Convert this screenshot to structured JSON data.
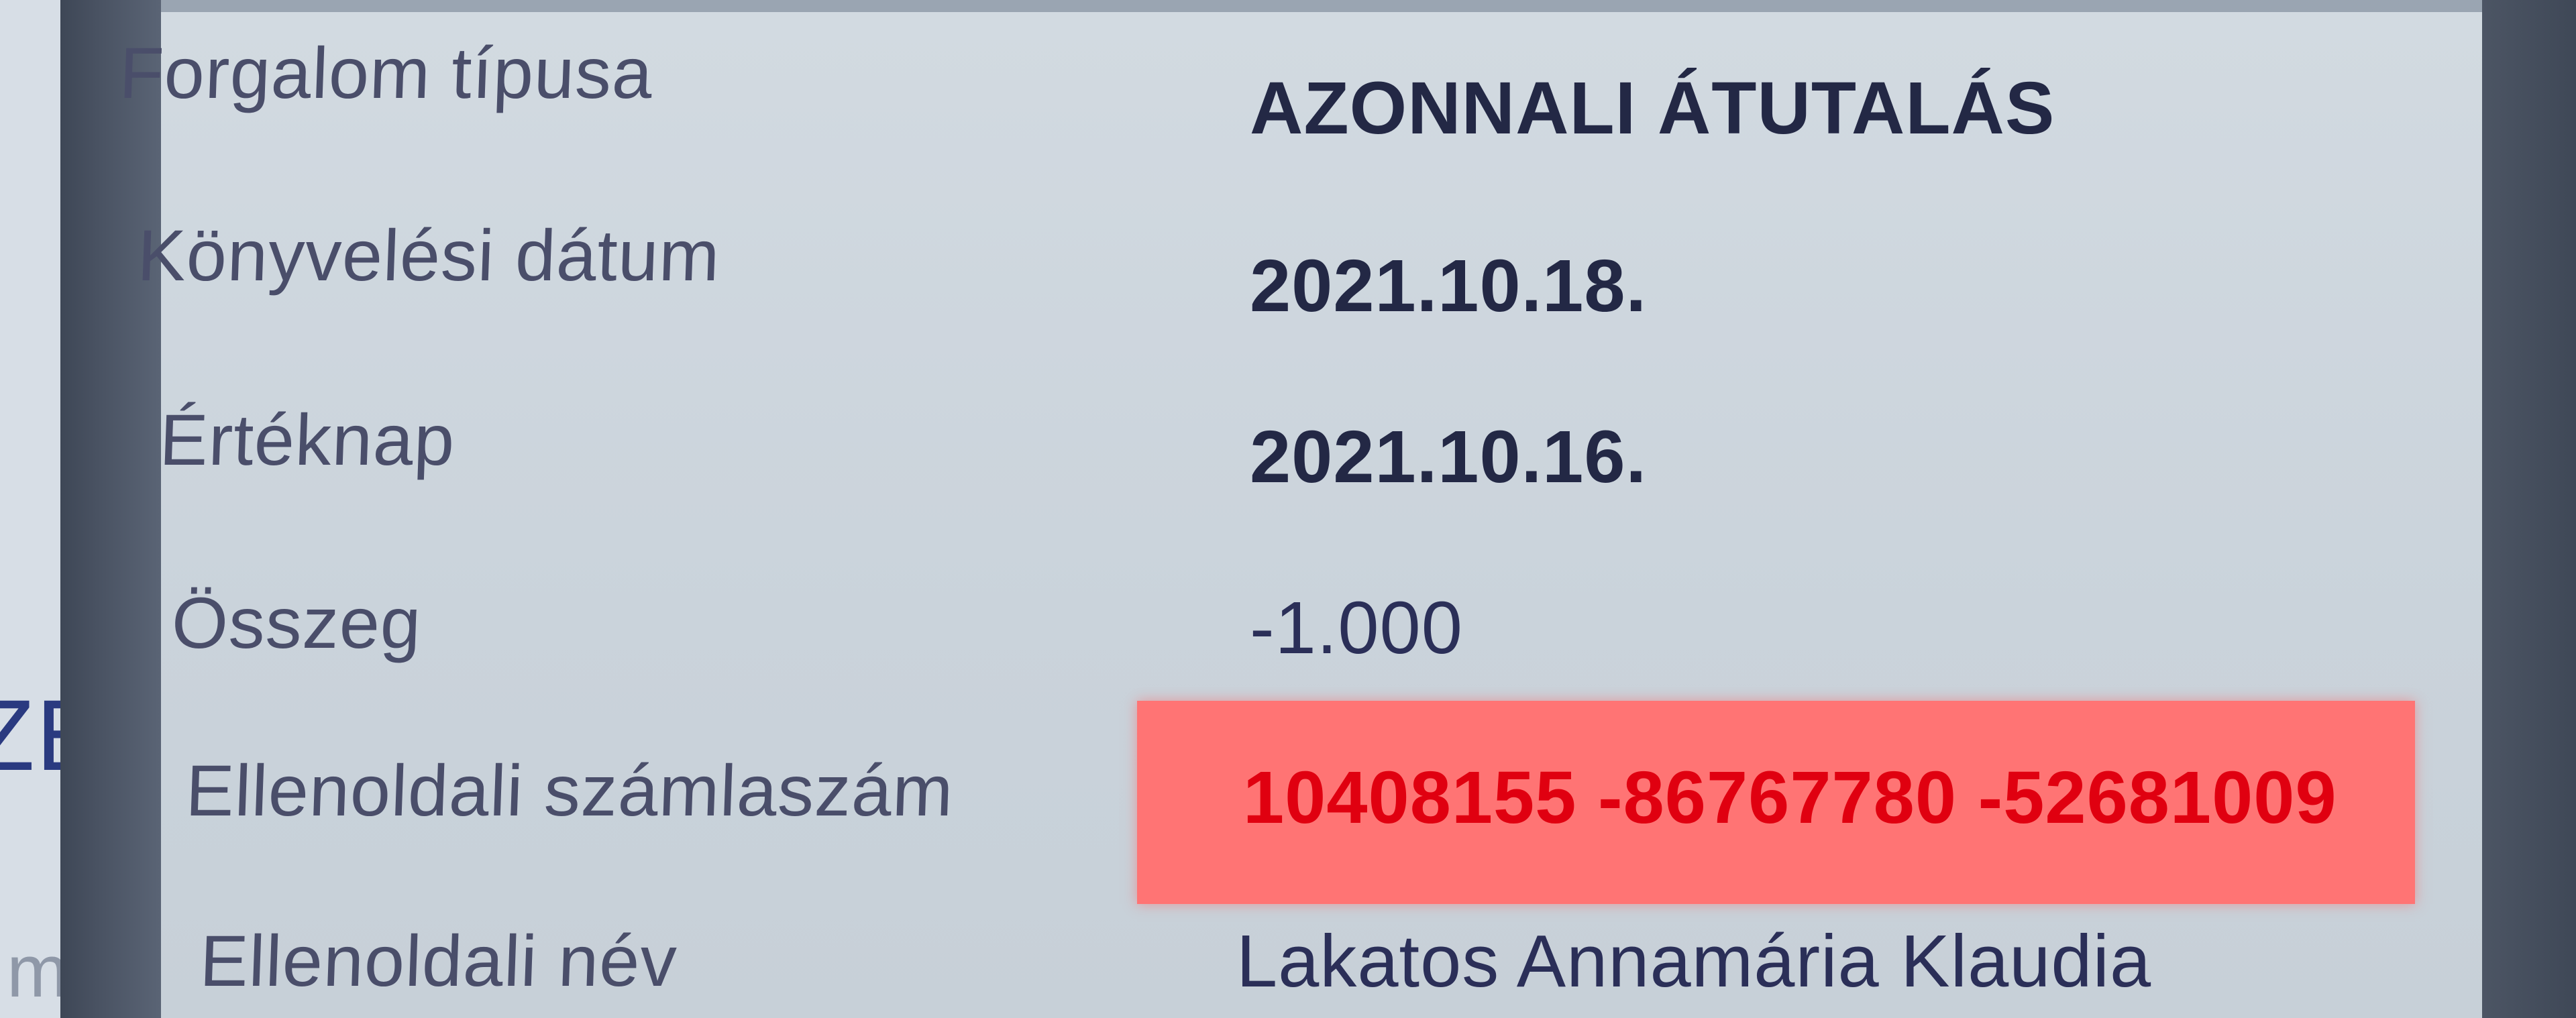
{
  "background": {
    "partial_text_1": "ZE",
    "partial_text_2": "mt"
  },
  "details": [
    {
      "label": "Forgalom típusa",
      "value": "AZONNALI ÁTUTALÁS"
    },
    {
      "label": "Könyvelési dátum",
      "value": "2021.10.18."
    },
    {
      "label": "Értéknap",
      "value": "2021.10.16."
    },
    {
      "label": "Összeg",
      "value": "-1.000"
    },
    {
      "label": "Ellenoldali számlaszám",
      "value": "10408155 -86767780 -52681009"
    },
    {
      "label": "Ellenoldali név",
      "value": "Lakatos Annamária Klaudia"
    }
  ],
  "colors": {
    "highlight_background": "#ff7474",
    "highlight_text": "#e00010"
  }
}
